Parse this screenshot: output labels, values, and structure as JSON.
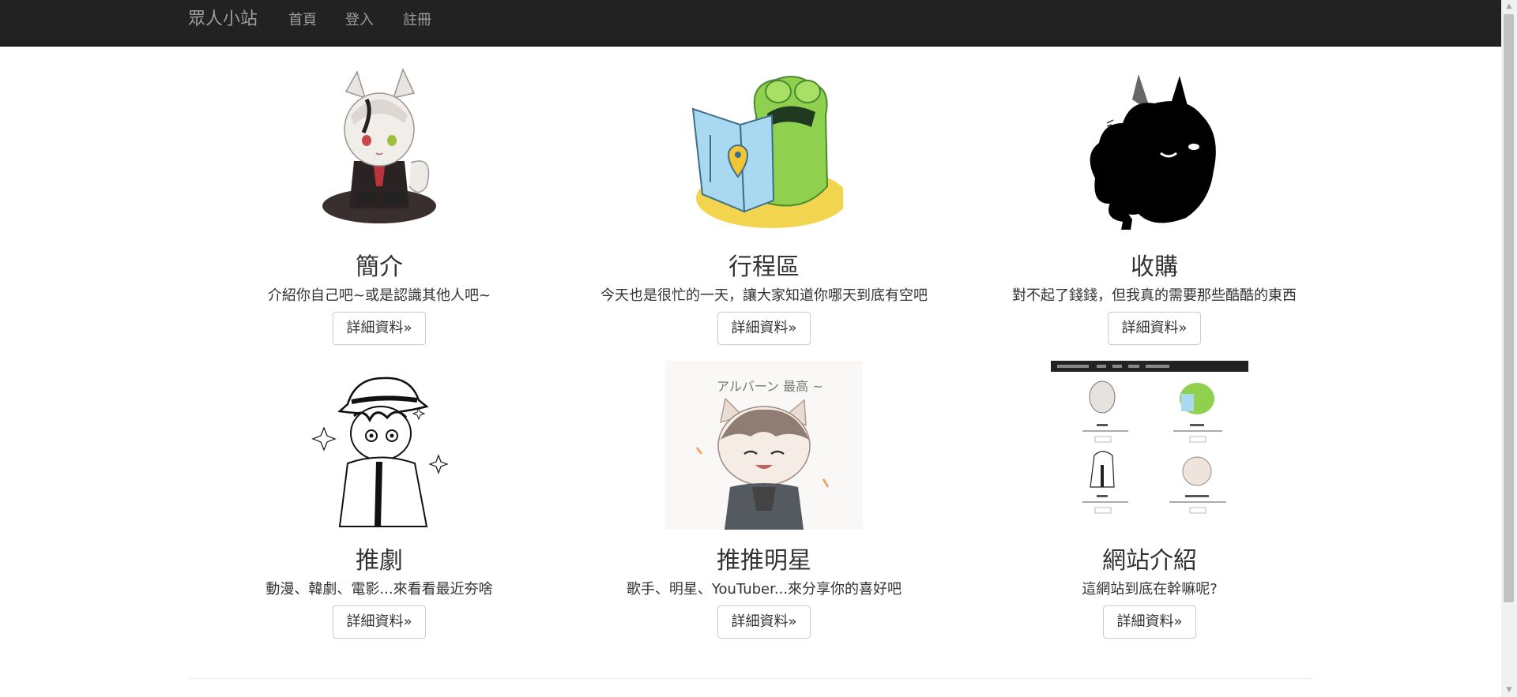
{
  "navbar": {
    "brand": "眾人小站",
    "links": [
      "首頁",
      "登入",
      "註冊"
    ]
  },
  "cards": [
    {
      "title": "簡介",
      "description": "介紹你自己吧~或是認識其他人吧~",
      "button": "詳細資料»",
      "image": "chibi-wolf-boy-illustration"
    },
    {
      "title": "行程區",
      "description": "今天也是很忙的一天，讓大家知道你哪天到底有空吧",
      "button": "詳細資料»",
      "image": "green-frog-reading-map-illustration"
    },
    {
      "title": "收購",
      "description": "對不起了錢錢，但我真的需要那些酷酷的東西",
      "button": "詳細資料»",
      "image": "black-fluffy-creature-silhouette"
    },
    {
      "title": "推劇",
      "description": "動漫、韓劇、電影...來看看最近夯啥",
      "button": "詳細資料»",
      "image": "manga-character-with-hat-lineart"
    },
    {
      "title": "推推明星",
      "description": "歌手、明星、YouTuber...來分享你的喜好吧",
      "button": "詳細資料»",
      "image": "chibi-cat-ear-boy-illustration"
    },
    {
      "title": "網站介紹",
      "description": "這網站到底在幹嘛呢?",
      "button": "詳細資料»",
      "image": "website-screenshot-preview"
    }
  ],
  "colors": {
    "navbar_bg": "#222222",
    "nav_text": "#9d9d9d",
    "button_border": "#cccccc"
  }
}
